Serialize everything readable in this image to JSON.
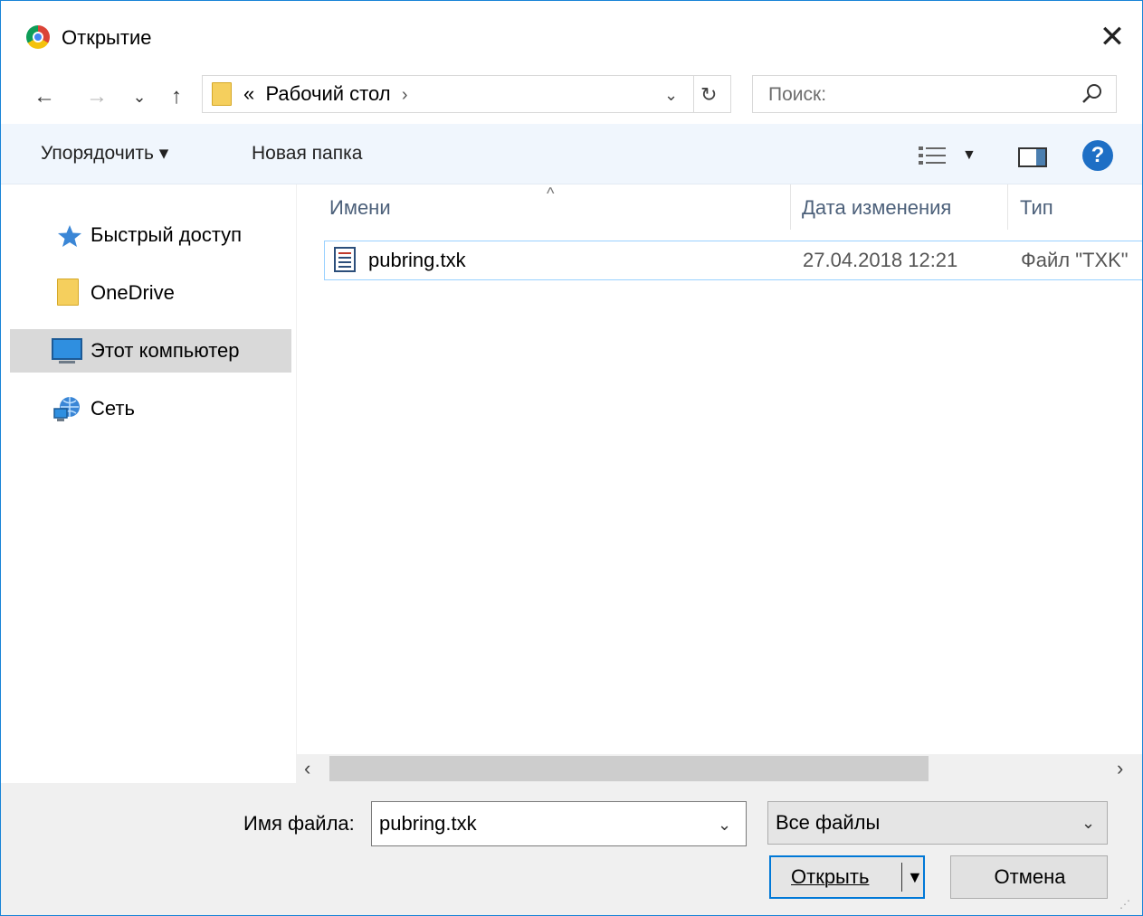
{
  "window": {
    "title": "Открытие",
    "close_glyph": "✕"
  },
  "nav": {
    "back_glyph": "←",
    "forward_glyph": "→",
    "recent_glyph": "⌄",
    "up_glyph": "↑",
    "address": {
      "prefix": "«",
      "path": "Рабочий стол",
      "suffix": "›",
      "dropdown_glyph": "⌄",
      "refresh_glyph": "↻"
    },
    "search": {
      "placeholder": "Поиск:"
    }
  },
  "toolbar": {
    "organize_label": "Упорядочить ▾",
    "new_folder_label": "Новая папка",
    "view_dropdown_glyph": "▼",
    "help_glyph": "?"
  },
  "sidebar": {
    "items": [
      {
        "label": "Быстрый доступ",
        "icon": "star-icon"
      },
      {
        "label": "OneDrive",
        "icon": "folder-icon"
      },
      {
        "label": "Этот компьютер",
        "icon": "computer-icon",
        "selected": true
      },
      {
        "label": "Сеть",
        "icon": "network-icon"
      }
    ]
  },
  "filelist": {
    "columns": [
      "Имени",
      "Дата изменения",
      "Тип"
    ],
    "sort_glyph": "^",
    "rows": [
      {
        "name": "pubring.txk",
        "date": "27.04.2018 12:21",
        "type": "Файл \"TXK\""
      }
    ]
  },
  "hscroll": {
    "left_glyph": "‹",
    "right_glyph": "›"
  },
  "bottom": {
    "filename_label": "Имя файла:",
    "filename_value": "pubring.txk",
    "dropdown_glyph": "⌄",
    "filetype_value": "Все файлы",
    "open_label": "Открыть",
    "open_dd_glyph": "▼",
    "cancel_label": "Отмена",
    "grip_glyph": "⋰"
  },
  "colors": {
    "accent": "#0078d7",
    "toolbar_bg": "#f0f6fd",
    "selected_bg": "#d9d9d9",
    "row_border": "#99d1ff",
    "help_blue": "#1e6fc5"
  }
}
